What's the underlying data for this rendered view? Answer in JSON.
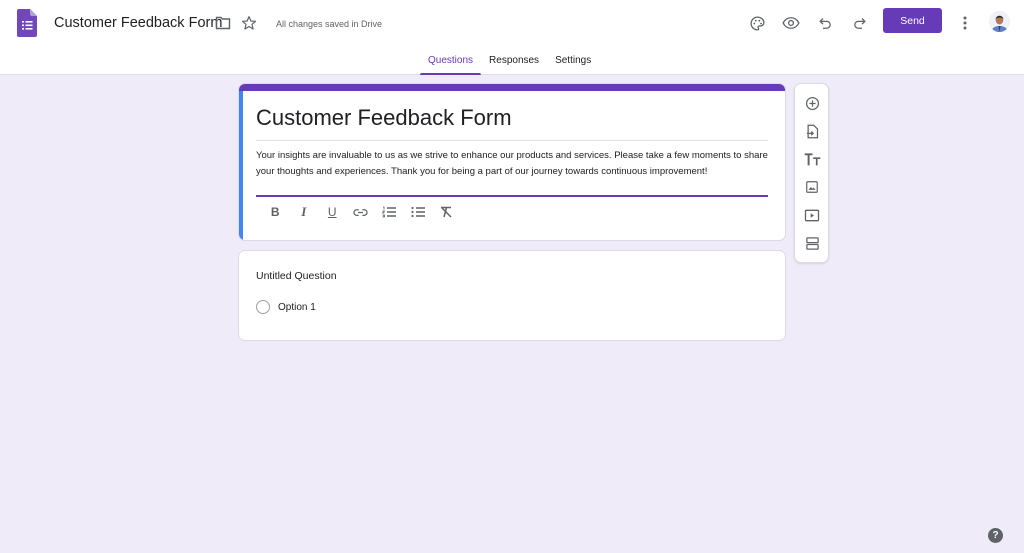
{
  "header": {
    "app_icon": "google-forms-icon",
    "doc_title": "Customer Feedback Form",
    "save_status": "All changes saved in Drive",
    "icons": [
      "folder-icon",
      "star-icon",
      "palette-icon",
      "eye-preview-icon",
      "undo-icon",
      "redo-icon",
      "more-vert-icon"
    ],
    "send_label": "Send",
    "brand_color": "#673ab7"
  },
  "tabs": [
    {
      "label": "Questions",
      "active": true
    },
    {
      "label": "Responses",
      "active": false
    },
    {
      "label": "Settings",
      "active": false
    }
  ],
  "title_card": {
    "title": "Customer Feedback Form",
    "description": "Your insights are invaluable to us as we strive to enhance our products and services. Please take a few moments to share your thoughts and experiences. Thank you for being a part of our journey towards continuous improvement!",
    "format_buttons": [
      "bold",
      "italic",
      "underline",
      "link",
      "numbered-list",
      "bulleted-list",
      "clear-formatting"
    ],
    "format_glyphs": [
      "B",
      "I",
      "U",
      "",
      "",
      "",
      ""
    ]
  },
  "question_card": {
    "title": "Untitled Question",
    "options": [
      "Option 1"
    ]
  },
  "side_toolbar": {
    "items": [
      "add-question",
      "import-questions",
      "add-title-description",
      "add-image",
      "add-video",
      "add-section"
    ]
  },
  "help_label": "?"
}
